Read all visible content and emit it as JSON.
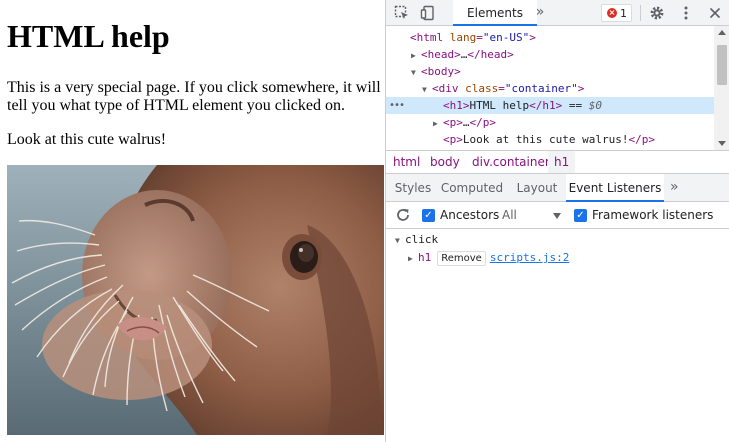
{
  "page": {
    "heading": "HTML help",
    "paragraph1": "This is a very special page. If you click somewhere, it will tell you what type of HTML element you clicked on.",
    "paragraph2": "Look at this cute walrus!"
  },
  "devtools": {
    "toolbar": {
      "inspect_icon": "inspect-element-icon",
      "device_icon": "device-toolbar-icon",
      "active_tab": "Elements",
      "more_tabs": "»",
      "error_count": "1",
      "settings_icon": "gear-icon",
      "menu_icon": "kebab-menu-icon",
      "close_icon": "close-icon"
    },
    "dom": [
      {
        "indent": 0,
        "tri": "",
        "parts": [
          [
            "tag",
            "<html "
          ],
          [
            "attr",
            "lang"
          ],
          [
            "tag",
            "="
          ],
          [
            "val",
            "\"en-US\""
          ],
          [
            "tag",
            ">"
          ]
        ]
      },
      {
        "indent": 1,
        "tri": "▶",
        "parts": [
          [
            "tag",
            "<head>"
          ],
          [
            "txt",
            "…"
          ],
          [
            "tag",
            "</head>"
          ]
        ]
      },
      {
        "indent": 1,
        "tri": "▼",
        "parts": [
          [
            "tag",
            "<body>"
          ]
        ]
      },
      {
        "indent": 2,
        "tri": "▼",
        "parts": [
          [
            "tag",
            "<div "
          ],
          [
            "attr",
            "class"
          ],
          [
            "tag",
            "="
          ],
          [
            "val",
            "\"container\""
          ],
          [
            "tag",
            ">"
          ]
        ]
      },
      {
        "indent": 3,
        "tri": "",
        "selected": true,
        "parts": [
          [
            "tag",
            "<h1>"
          ],
          [
            "txt",
            "HTML help"
          ],
          [
            "tag",
            "</h1>"
          ],
          [
            "txt",
            " == "
          ],
          [
            "cm",
            "$0"
          ]
        ]
      },
      {
        "indent": 3,
        "tri": "▶",
        "parts": [
          [
            "tag",
            "<p>"
          ],
          [
            "txt",
            "…"
          ],
          [
            "tag",
            "</p>"
          ]
        ]
      },
      {
        "indent": 3,
        "tri": "",
        "parts": [
          [
            "tag",
            "<p>"
          ],
          [
            "txt",
            "Look at this cute walrus!"
          ],
          [
            "tag",
            "</p>"
          ]
        ]
      }
    ],
    "breadcrumbs": [
      "html",
      "body",
      "div.container",
      "h1"
    ],
    "subtabs": [
      "Styles",
      "Computed",
      "Layout",
      "Event Listeners"
    ],
    "subtabs_active": "Event Listeners",
    "subtabs_more": "»",
    "filter": {
      "ancestors_label": "Ancestors",
      "select_value": "All",
      "framework_label": "Framework listeners"
    },
    "listeners": {
      "event": "click",
      "element": "h1",
      "remove_label": "Remove",
      "source": "scripts.js:2"
    }
  },
  "colors": {
    "selection": "#cfe8fc",
    "accent": "#1a73e8",
    "tag": "#881280",
    "error": "#d93025"
  }
}
